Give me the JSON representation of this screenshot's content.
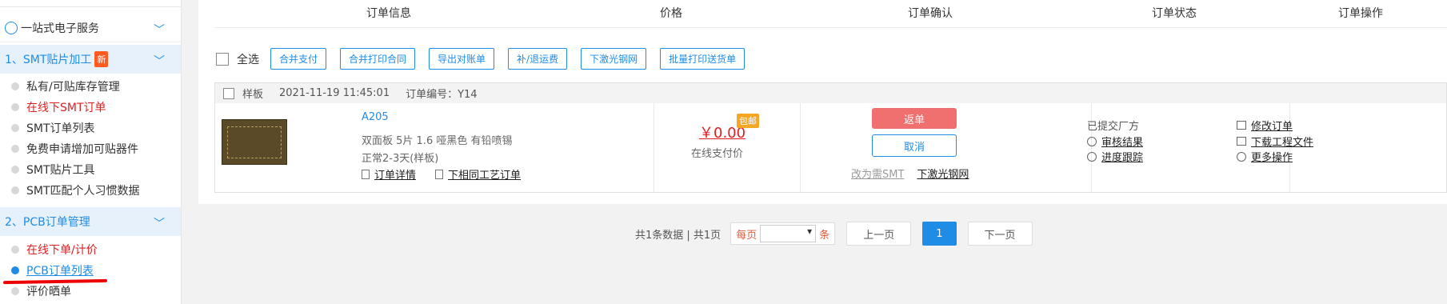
{
  "sidebar": {
    "section0": {
      "label": "一站式电子服务"
    },
    "section1": {
      "label": "1、SMT贴片加工",
      "badge": "新"
    },
    "smt_items": [
      {
        "label": "私有/可贴库存管理"
      },
      {
        "label": "在线下SMT订单"
      },
      {
        "label": "SMT订单列表"
      },
      {
        "label": "免费申请增加可贴器件"
      },
      {
        "label": "SMT贴片工具"
      },
      {
        "label": "SMT匹配个人习惯数据"
      }
    ],
    "section2": {
      "label": "2、PCB订单管理"
    },
    "pcb_items": [
      {
        "label": "在线下单/计价"
      },
      {
        "label": "PCB订单列表"
      },
      {
        "label": "评价晒单"
      }
    ]
  },
  "columns": [
    "订单信息",
    "价格",
    "订单确认",
    "订单状态",
    "订单操作"
  ],
  "toolbar": {
    "select_all": "全选",
    "buttons": [
      "合并支付",
      "合并打印合同",
      "导出对账单",
      "补/退运费",
      "下激光钢网",
      "批量打印送货单"
    ]
  },
  "order": {
    "type": "样板",
    "datetime": "2021-11-19 11:45:01",
    "order_no": "订单编号：Y14",
    "name": "A205",
    "spec": "双面板   5片   1.6   哑黑色   有铅喷锡",
    "lead_time": "正常2-3天(样板)",
    "detail_link": "订单详情",
    "same_process_link": "下相同工艺订单",
    "price": "￥0.00",
    "free_shipping": "包邮",
    "price_note": "在线支付价",
    "return_btn": "返单",
    "cancel_btn": "取消",
    "change_smt": "改为需SMT",
    "laser_stencil": "下激光钢网",
    "status": "已提交厂方",
    "audit_result": "审核结果",
    "progress": "进度跟踪",
    "modify": "修改订单",
    "download": "下载工程文件",
    "more": "更多操作"
  },
  "pager": {
    "summary": "共1条数据 | 共1页",
    "per_page": "每页",
    "unit": "条",
    "prev": "上一页",
    "current": "1",
    "next": "下一页"
  }
}
